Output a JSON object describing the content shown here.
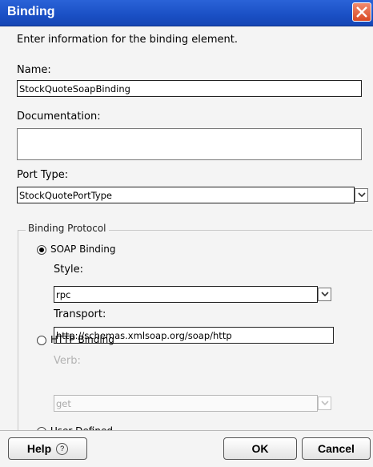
{
  "window": {
    "title": "Binding"
  },
  "intro_text": "Enter information for the binding element.",
  "name": {
    "label": "Name:",
    "value": "StockQuoteSoapBinding"
  },
  "documentation": {
    "label": "Documentation:",
    "value": ""
  },
  "port_type": {
    "label": "Port Type:",
    "value": "StockQuotePortType"
  },
  "binding_protocol": {
    "group_title": "Binding Protocol",
    "soap": {
      "label": "SOAP Binding",
      "selected": true,
      "style_label": "Style:",
      "style_value": "rpc",
      "transport_label": "Transport:",
      "transport_value": "http://schemas.xmlsoap.org/soap/http"
    },
    "http": {
      "label": "HTTP Binding",
      "selected": false,
      "verb_label": "Verb:",
      "verb_value": "get"
    },
    "user_defined": {
      "label": "User Defined",
      "selected": false
    }
  },
  "footer": {
    "help_label": "Help",
    "help_icon": "question-circle-icon",
    "ok_label": "OK",
    "cancel_label": "Cancel"
  },
  "colors": {
    "titlebar": "#1a4fc4",
    "close_button": "#d94a24"
  }
}
